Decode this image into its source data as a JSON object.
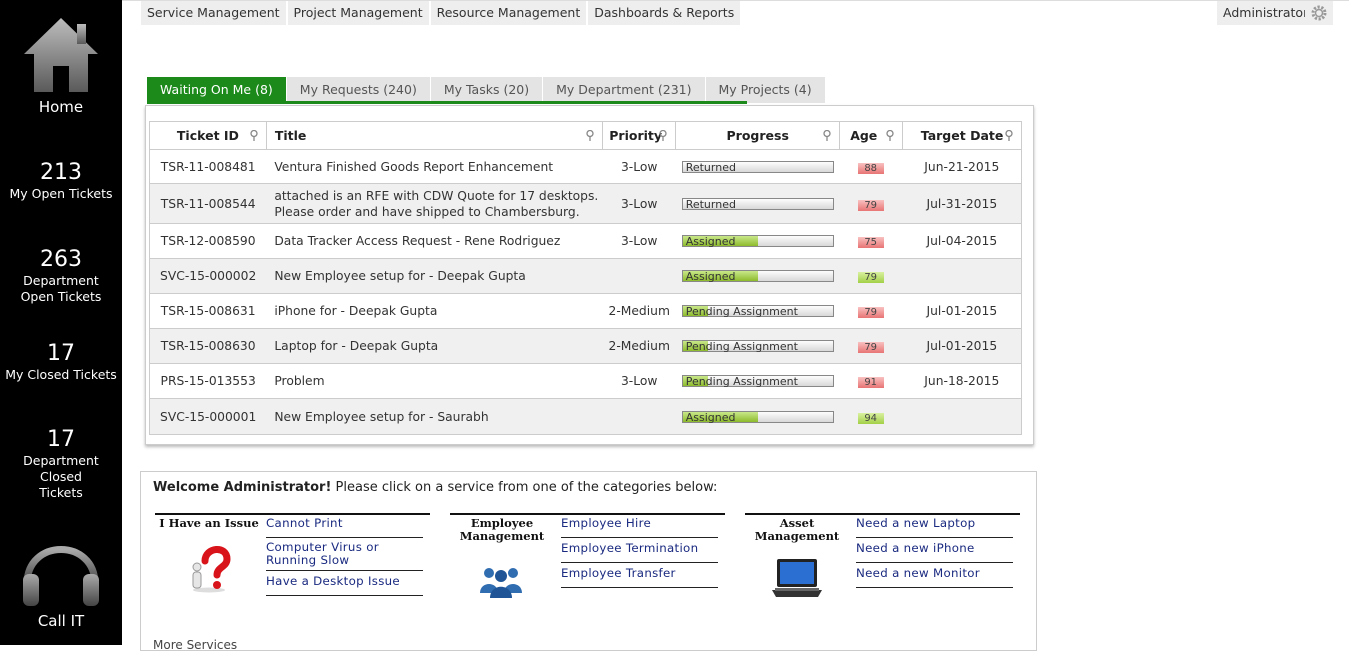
{
  "sidebar": {
    "home": "Home",
    "stats": [
      {
        "num": "213",
        "label": "My Open Tickets"
      },
      {
        "num": "263",
        "label": "Department Open Tickets"
      },
      {
        "num": "17",
        "label": "My Closed Tickets"
      },
      {
        "num": "17",
        "label": "Department Closed Tickets"
      }
    ],
    "call": "Call IT"
  },
  "topmenu": [
    "Service Management",
    "Project Management",
    "Resource Management",
    "Dashboards & Reports"
  ],
  "user": "Administrator",
  "tabs": [
    "Waiting On Me (8)",
    "My Requests (240)",
    "My Tasks (20)",
    "My Department (231)",
    "My Projects (4)"
  ],
  "grid": {
    "headers": [
      "Ticket ID",
      "Title",
      "Priority",
      "Progress",
      "Age",
      "Target Date"
    ],
    "rows": [
      {
        "id": "TSR-11-008481",
        "title": "Ventura Finished Goods Report Enhancement",
        "priority": "3-Low",
        "progress": "Returned",
        "progress_pct": 0,
        "age": "88",
        "age_status": "red",
        "date": "Jun-21-2015"
      },
      {
        "id": "TSR-11-008544",
        "title": "attached is an RFE with CDW Quote for 17 desktops. Please order and have shipped to Chambersburg.",
        "priority": "3-Low",
        "progress": "Returned",
        "progress_pct": 0,
        "age": "79",
        "age_status": "red",
        "date": "Jul-31-2015"
      },
      {
        "id": "TSR-12-008590",
        "title": "Data Tracker Access Request - Rene Rodriguez",
        "priority": "3-Low",
        "progress": "Assigned",
        "progress_pct": 50,
        "age": "75",
        "age_status": "red",
        "date": "Jul-04-2015"
      },
      {
        "id": "SVC-15-000002",
        "title": "New Employee setup for - Deepak Gupta",
        "priority": "",
        "progress": "Assigned",
        "progress_pct": 50,
        "age": "79",
        "age_status": "green",
        "date": ""
      },
      {
        "id": "TSR-15-008631",
        "title": "iPhone for - Deepak Gupta",
        "priority": "2-Medium",
        "progress": "Pending Assignment",
        "progress_pct": 17,
        "age": "79",
        "age_status": "red",
        "date": "Jul-01-2015"
      },
      {
        "id": "TSR-15-008630",
        "title": "Laptop for - Deepak Gupta",
        "priority": "2-Medium",
        "progress": "Pending Assignment",
        "progress_pct": 17,
        "age": "79",
        "age_status": "red",
        "date": "Jul-01-2015"
      },
      {
        "id": "PRS-15-013553",
        "title": "Problem",
        "priority": "3-Low",
        "progress": "Pending Assignment",
        "progress_pct": 17,
        "age": "91",
        "age_status": "red",
        "date": "Jun-18-2015"
      },
      {
        "id": "SVC-15-000001",
        "title": "New Employee setup for - Saurabh",
        "priority": "",
        "progress": "Assigned",
        "progress_pct": 50,
        "age": "94",
        "age_status": "green",
        "date": ""
      }
    ]
  },
  "welcome": {
    "bold": "Welcome Administrator!",
    "text": " Please click on a service from one of the categories below:",
    "categories": [
      {
        "name": "I Have an Issue",
        "icon": "question-person-icon",
        "links": [
          "Cannot Print",
          "Computer Virus or Running Slow",
          "Have a Desktop Issue"
        ]
      },
      {
        "name": "Employee Management",
        "icon": "people-group-icon",
        "links": [
          "Employee Hire",
          "Employee Termination",
          "Employee Transfer"
        ]
      },
      {
        "name": "Asset Management",
        "icon": "laptop-icon",
        "links": [
          "Need a new Laptop",
          "Need a new iPhone",
          "Need a new Monitor"
        ]
      }
    ],
    "more": "More Services"
  },
  "colors": {
    "sidebar": "#000000",
    "active_tab": "#1b8a1b",
    "link": "#1a2a80",
    "age_red": "#e87474",
    "age_green": "#a3cf47"
  }
}
